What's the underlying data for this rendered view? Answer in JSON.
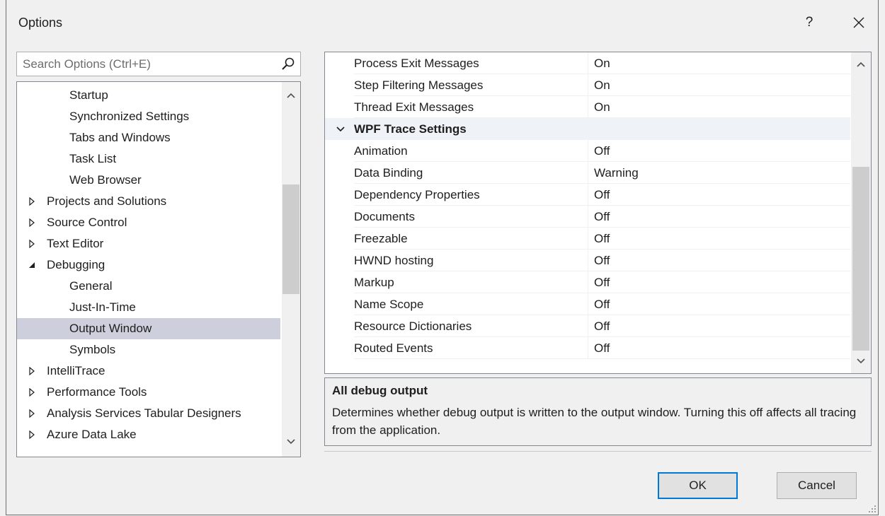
{
  "window": {
    "title": "Options",
    "help_label": "?"
  },
  "search": {
    "placeholder": "Search Options (Ctrl+E)"
  },
  "tree": {
    "items": [
      {
        "label": "Startup",
        "level": 2,
        "expander": "none",
        "selected": false
      },
      {
        "label": "Synchronized Settings",
        "level": 2,
        "expander": "none",
        "selected": false
      },
      {
        "label": "Tabs and Windows",
        "level": 2,
        "expander": "none",
        "selected": false
      },
      {
        "label": "Task List",
        "level": 2,
        "expander": "none",
        "selected": false
      },
      {
        "label": "Web Browser",
        "level": 2,
        "expander": "none",
        "selected": false
      },
      {
        "label": "Projects and Solutions",
        "level": 1,
        "expander": "collapsed",
        "selected": false
      },
      {
        "label": "Source Control",
        "level": 1,
        "expander": "collapsed",
        "selected": false
      },
      {
        "label": "Text Editor",
        "level": 1,
        "expander": "collapsed",
        "selected": false
      },
      {
        "label": "Debugging",
        "level": 1,
        "expander": "expanded",
        "selected": false
      },
      {
        "label": "General",
        "level": 2,
        "expander": "none",
        "selected": false
      },
      {
        "label": "Just-In-Time",
        "level": 2,
        "expander": "none",
        "selected": false
      },
      {
        "label": "Output Window",
        "level": 2,
        "expander": "none",
        "selected": true
      },
      {
        "label": "Symbols",
        "level": 2,
        "expander": "none",
        "selected": false
      },
      {
        "label": "IntelliTrace",
        "level": 1,
        "expander": "collapsed",
        "selected": false
      },
      {
        "label": "Performance Tools",
        "level": 1,
        "expander": "collapsed",
        "selected": false
      },
      {
        "label": "Analysis Services Tabular Designers",
        "level": 1,
        "expander": "collapsed",
        "selected": false
      },
      {
        "label": "Azure Data Lake",
        "level": 1,
        "expander": "collapsed",
        "selected": false
      }
    ]
  },
  "grid": {
    "rows": [
      {
        "kind": "item",
        "name": "Process Exit Messages",
        "value": "On"
      },
      {
        "kind": "item",
        "name": "Step Filtering Messages",
        "value": "On"
      },
      {
        "kind": "item",
        "name": "Thread Exit Messages",
        "value": "On"
      },
      {
        "kind": "category",
        "name": "WPF Trace Settings",
        "value": ""
      },
      {
        "kind": "item",
        "name": "Animation",
        "value": "Off"
      },
      {
        "kind": "item",
        "name": "Data Binding",
        "value": "Warning"
      },
      {
        "kind": "item",
        "name": "Dependency Properties",
        "value": "Off"
      },
      {
        "kind": "item",
        "name": "Documents",
        "value": "Off"
      },
      {
        "kind": "item",
        "name": "Freezable",
        "value": "Off"
      },
      {
        "kind": "item",
        "name": "HWND hosting",
        "value": "Off"
      },
      {
        "kind": "item",
        "name": "Markup",
        "value": "Off"
      },
      {
        "kind": "item",
        "name": "Name Scope",
        "value": "Off"
      },
      {
        "kind": "item",
        "name": "Resource Dictionaries",
        "value": "Off"
      },
      {
        "kind": "item",
        "name": "Routed Events",
        "value": "Off"
      }
    ]
  },
  "description": {
    "title": "All debug output",
    "text": "Determines whether debug output is written to the output window. Turning this off affects all tracing from the application."
  },
  "buttons": {
    "ok": "OK",
    "cancel": "Cancel"
  },
  "colors": {
    "selection": "#cdd0dc",
    "category_band": "#eff2f7",
    "default_border": "#0078d7"
  }
}
